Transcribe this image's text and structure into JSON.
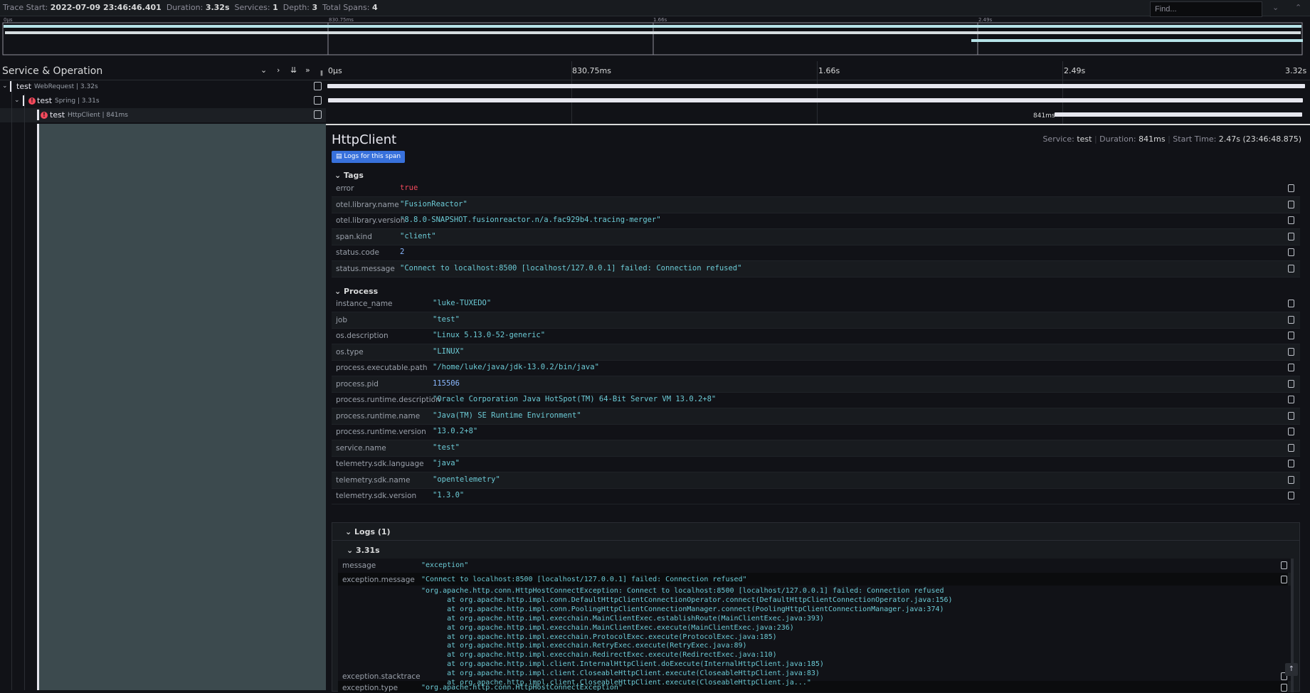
{
  "header": {
    "trace_start_label": "Trace Start:",
    "trace_start": "2022-07-09 23:46:46.401",
    "duration_label": "Duration:",
    "duration": "3.32s",
    "services_label": "Services:",
    "services": "1",
    "depth_label": "Depth:",
    "depth": "3",
    "total_spans_label": "Total Spans:",
    "total_spans": "4",
    "find_placeholder": "Find...",
    "next_icon": "⌄",
    "prev_icon": "⌃"
  },
  "minimap": {
    "ticks": [
      "0μs",
      "830.75ms",
      "1.66s",
      "2.49s"
    ]
  },
  "left_panel": {
    "title": "Service & Operation",
    "rows": [
      {
        "service": "test",
        "operation": "WebRequest | 3.32s",
        "error": false
      },
      {
        "service": "test",
        "operation": "Spring | 3.31s",
        "error": true
      },
      {
        "service": "test",
        "operation": "HttpClient | 841ms",
        "error": true
      }
    ]
  },
  "timeline": {
    "ticks": [
      "0μs",
      "830.75ms",
      "1.66s",
      "2.49s",
      "3.32s"
    ],
    "span3_label": "841ms",
    "spans": [
      {
        "start": 0,
        "end": 3.32
      },
      {
        "start": 0.003,
        "end": 3.313
      },
      {
        "start": 2.47,
        "end": 3.311
      }
    ],
    "total": 3.32
  },
  "detail": {
    "title": "HttpClient",
    "service_label": "Service:",
    "service": "test",
    "duration_label": "Duration:",
    "duration": "841ms",
    "start_label": "Start Time:",
    "start": "2.47s (23:46:48.875)",
    "logs_button": "Logs for this span",
    "tags_title": "Tags",
    "tags": [
      {
        "key": "error",
        "value": "true",
        "kind": "red"
      },
      {
        "key": "otel.library.name",
        "value": "\"FusionReactor\"",
        "kind": "str"
      },
      {
        "key": "otel.library.version",
        "value": "\"8.8.0-SNAPSHOT.fusionreactor.n/a.fac929b4.tracing-merger\"",
        "kind": "str"
      },
      {
        "key": "span.kind",
        "value": "\"client\"",
        "kind": "str"
      },
      {
        "key": "status.code",
        "value": "2",
        "kind": "num"
      },
      {
        "key": "status.message",
        "value": "\"Connect to localhost:8500 [localhost/127.0.0.1] failed: Connection refused\"",
        "kind": "str"
      }
    ],
    "process_title": "Process",
    "process": [
      {
        "key": "instance_name",
        "value": "\"luke-TUXEDO\"",
        "kind": "str"
      },
      {
        "key": "job",
        "value": "\"test\"",
        "kind": "str"
      },
      {
        "key": "os.description",
        "value": "\"Linux 5.13.0-52-generic\"",
        "kind": "str"
      },
      {
        "key": "os.type",
        "value": "\"LINUX\"",
        "kind": "str"
      },
      {
        "key": "process.executable.path",
        "value": "\"/home/luke/java/jdk-13.0.2/bin/java\"",
        "kind": "str"
      },
      {
        "key": "process.pid",
        "value": "115506",
        "kind": "num"
      },
      {
        "key": "process.runtime.description",
        "value": "\"Oracle Corporation Java HotSpot(TM) 64-Bit Server VM 13.0.2+8\"",
        "kind": "str"
      },
      {
        "key": "process.runtime.name",
        "value": "\"Java(TM) SE Runtime Environment\"",
        "kind": "str"
      },
      {
        "key": "process.runtime.version",
        "value": "\"13.0.2+8\"",
        "kind": "str"
      },
      {
        "key": "service.name",
        "value": "\"test\"",
        "kind": "str"
      },
      {
        "key": "telemetry.sdk.language",
        "value": "\"java\"",
        "kind": "str"
      },
      {
        "key": "telemetry.sdk.name",
        "value": "\"opentelemetry\"",
        "kind": "str"
      },
      {
        "key": "telemetry.sdk.version",
        "value": "\"1.3.0\"",
        "kind": "str"
      }
    ],
    "logs_title": "Logs (1)",
    "log_time": "3.31s",
    "log_fields": {
      "message_key": "message",
      "message": "\"exception\"",
      "exception_message_key": "exception.message",
      "exception_message": "\"Connect to localhost:8500 [localhost/127.0.0.1] failed: Connection refused\"",
      "stacktrace_key": "exception.stacktrace",
      "stacktrace": "\"org.apache.http.conn.HttpHostConnectException: Connect to localhost:8500 [localhost/127.0.0.1] failed: Connection refused\n\tat org.apache.http.impl.conn.DefaultHttpClientConnectionOperator.connect(DefaultHttpClientConnectionOperator.java:156)\n\tat org.apache.http.impl.conn.PoolingHttpClientConnectionManager.connect(PoolingHttpClientConnectionManager.java:374)\n\tat org.apache.http.impl.execchain.MainClientExec.establishRoute(MainClientExec.java:393)\n\tat org.apache.http.impl.execchain.MainClientExec.execute(MainClientExec.java:236)\n\tat org.apache.http.impl.execchain.ProtocolExec.execute(ProtocolExec.java:185)\n\tat org.apache.http.impl.execchain.RetryExec.execute(RetryExec.java:89)\n\tat org.apache.http.impl.execchain.RedirectExec.execute(RedirectExec.java:110)\n\tat org.apache.http.impl.client.InternalHttpClient.doExecute(InternalHttpClient.java:185)\n\tat org.apache.http.impl.client.CloseableHttpClient.execute(CloseableHttpClient.java:83)\n\tat org.apache.http.impl.client.CloseableHttpClient.execute(CloseableHttpClient.ja...\"",
      "exception_type_key": "exception.type",
      "exception_type": "\"org.apache.http.conn.HttpHostConnectException\""
    }
  }
}
